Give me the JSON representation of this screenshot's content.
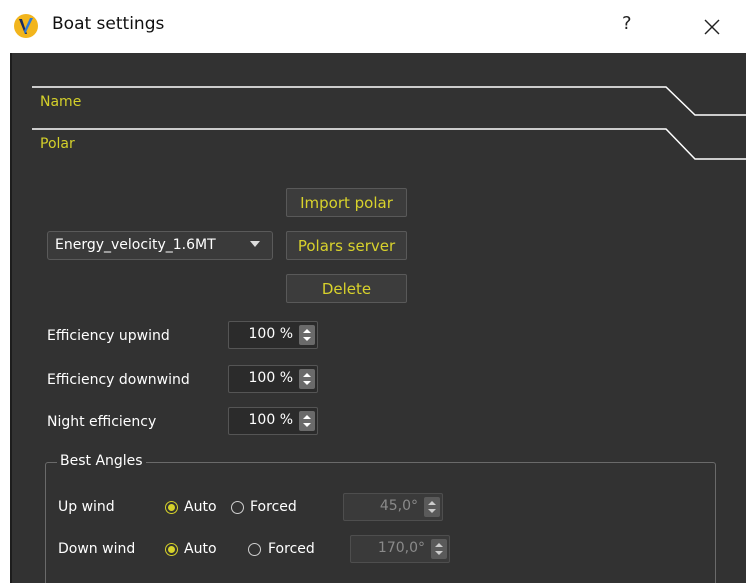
{
  "window": {
    "title": "Boat settings",
    "help": "?",
    "icons": [
      "app-logo-icon",
      "close-icon"
    ]
  },
  "sections": {
    "name": "Name",
    "polar": "Polar"
  },
  "polar": {
    "selected": "Energy_velocity_1.6MT",
    "import_label": "Import polar",
    "server_label": "Polars server",
    "delete_label": "Delete"
  },
  "efficiency": {
    "upwind_label": "Efficiency upwind",
    "upwind_value": "100 %",
    "downwind_label": "Efficiency downwind",
    "downwind_value": "100 %",
    "night_label": "Night efficiency",
    "night_value": "100 %"
  },
  "best_angles": {
    "title": "Best Angles",
    "auto_label": "Auto",
    "forced_label": "Forced",
    "upwind": {
      "label": "Up wind",
      "mode": "Auto",
      "value": "45,0°"
    },
    "downwind": {
      "label": "Down wind",
      "mode": "Auto",
      "value": "170,0°"
    }
  },
  "colors": {
    "background": "#323232",
    "accent": "#d6d22a",
    "text": "#ffffff"
  }
}
